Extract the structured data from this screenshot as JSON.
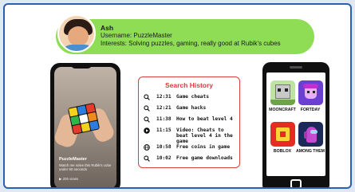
{
  "profile": {
    "name": "Ash",
    "username": "Username: PuzzleMaster",
    "interests": "Interests: Solving puzzles, gaming, really good at Rubik's cubes"
  },
  "video": {
    "user": "PuzzleMaster",
    "caption": "Watch me solve this Rubik's cube under 60 seconds",
    "views": "▶ 205 views"
  },
  "history": {
    "title": "Search History",
    "items": [
      {
        "icon": "search-icon",
        "time": "12:31",
        "query": "Game cheats"
      },
      {
        "icon": "search-icon",
        "time": "12:21",
        "query": "Game hacks"
      },
      {
        "icon": "search-icon",
        "time": "11:38",
        "query": "How to beat level 4"
      },
      {
        "icon": "play-icon",
        "time": "11:15",
        "query": "Video: Cheats to beat level 4 in the game"
      },
      {
        "icon": "globe-icon",
        "time": "10:58",
        "query": "Free coins in game"
      },
      {
        "icon": "search-icon",
        "time": "10:02",
        "query": "Free game downloads"
      }
    ]
  },
  "apps": [
    {
      "label": "MOONCRAFT",
      "icon": "mooncraft-app-icon"
    },
    {
      "label": "FORTDAY",
      "icon": "fortday-app-icon"
    },
    {
      "label": "BOBLOX",
      "icon": "boblox-app-icon"
    },
    {
      "label": "AMONG THEM",
      "icon": "among-them-app-icon"
    }
  ],
  "colors": {
    "banner": "#8fdc55",
    "history_accent": "#d93b3b",
    "frame_border": "#2a60b0"
  }
}
